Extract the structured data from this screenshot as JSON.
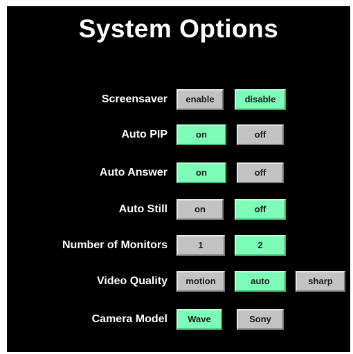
{
  "title": "System Options",
  "colors": {
    "panel_background": "#000000",
    "selected_button": "#7dfcb8",
    "unselected_button": "#c2c2c2",
    "label_text": "#ffffff"
  },
  "options": [
    {
      "label": "Screensaver",
      "choices": [
        {
          "text": "enable",
          "selected": false
        },
        {
          "text": "disable",
          "selected": true
        }
      ]
    },
    {
      "label": "Auto PIP",
      "choices": [
        {
          "text": "on",
          "selected": true
        },
        {
          "text": "off",
          "selected": false
        }
      ]
    },
    {
      "label": "Auto Answer",
      "choices": [
        {
          "text": "on",
          "selected": true
        },
        {
          "text": "off",
          "selected": false
        }
      ]
    },
    {
      "label": "Auto Still",
      "choices": [
        {
          "text": "on",
          "selected": false
        },
        {
          "text": "off",
          "selected": true
        }
      ]
    },
    {
      "label": "Number of Monitors",
      "choices": [
        {
          "text": "1",
          "selected": false
        },
        {
          "text": "2",
          "selected": true
        }
      ]
    },
    {
      "label": "Video Quality",
      "choices": [
        {
          "text": "motion",
          "selected": false
        },
        {
          "text": "auto",
          "selected": true
        },
        {
          "text": "sharp",
          "selected": false
        }
      ]
    },
    {
      "label": "Camera Model",
      "choices": [
        {
          "text": "Wave",
          "selected": true
        },
        {
          "text": "Sony",
          "selected": false
        }
      ]
    }
  ]
}
